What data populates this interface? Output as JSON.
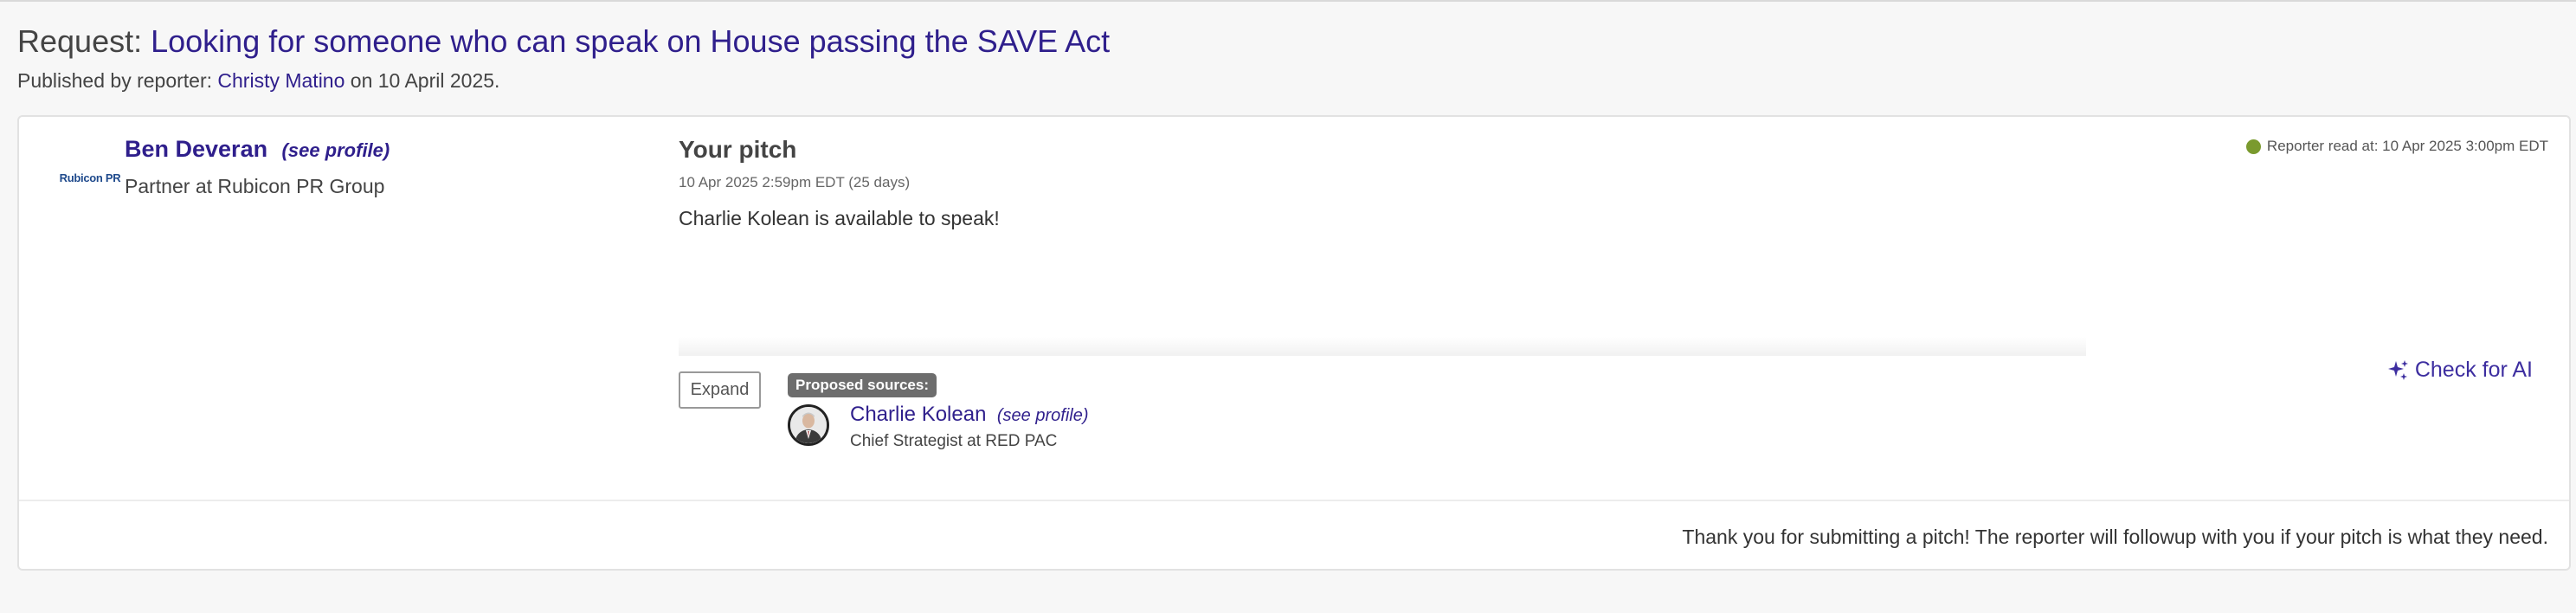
{
  "header": {
    "request_prefix": "Request:",
    "request_title": "Looking for someone who can speak on House passing the SAVE Act",
    "published_prefix": "Published by reporter:",
    "reporter_name": "Christy Matino",
    "published_suffix": " on 10 April 2025."
  },
  "pitch_card": {
    "logo_text": "Rubicon PR",
    "person": {
      "name": "Ben Deveran",
      "see_profile": "(see profile)",
      "title": "Partner at Rubicon PR Group"
    },
    "pitch": {
      "heading": "Your pitch",
      "meta": "10 Apr 2025 2:59pm EDT (25 days)",
      "body": "Charlie Kolean is available to speak!"
    },
    "read_status": {
      "text": "Reporter read at: 10 Apr 2025 3:00pm EDT",
      "dot_color": "#7a9a2e"
    },
    "expand_label": "Expand",
    "proposed_label": "Proposed sources:",
    "source": {
      "name": "Charlie Kolean",
      "see_profile": "(see profile)",
      "title": "Chief Strategist at RED PAC"
    },
    "check_ai": {
      "label": "Check for AI",
      "icon": "sparkle-icon"
    },
    "footer_message": "Thank you for submitting a pitch! The reporter will followup with you if your pitch is what they need."
  },
  "colors": {
    "accent": "#2f1f8c",
    "background": "#f7f7f7"
  }
}
